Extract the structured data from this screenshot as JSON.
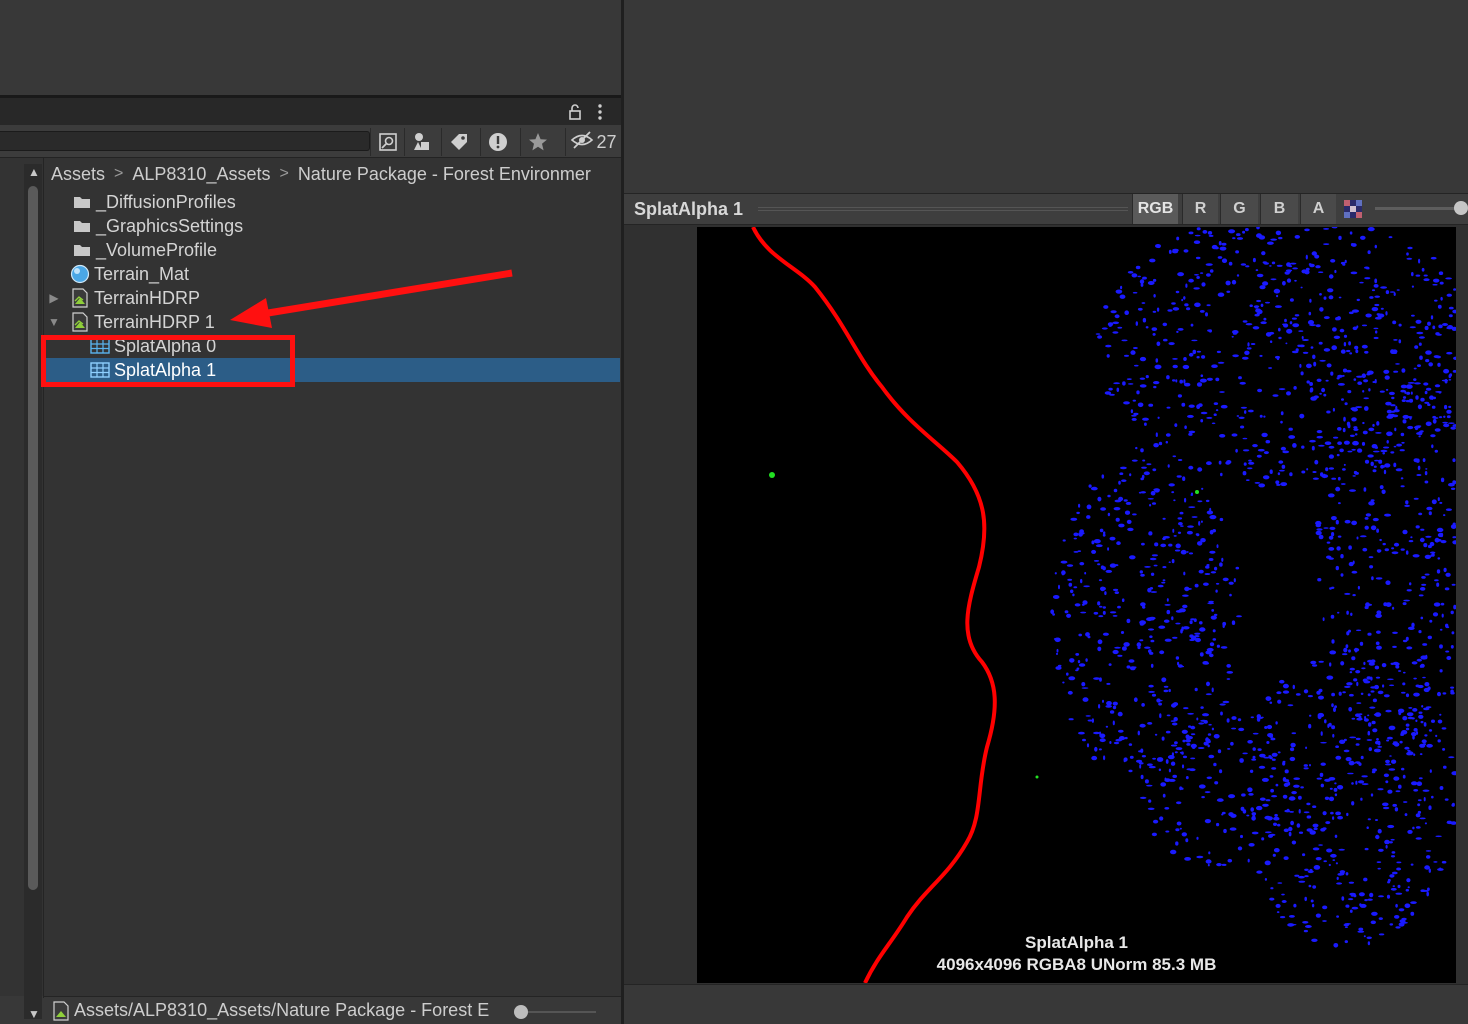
{
  "project": {
    "hidden_count": "27",
    "breadcrumb": [
      "Assets",
      "ALP8310_Assets",
      "Nature Package - Forest Environmer"
    ],
    "tree": [
      {
        "label": "_DiffusionProfiles",
        "icon": "folder-icon"
      },
      {
        "label": "_GraphicsSettings",
        "icon": "folder-icon"
      },
      {
        "label": "_VolumeProfile",
        "icon": "folder-icon"
      },
      {
        "label": "Terrain_Mat",
        "icon": "material-icon"
      },
      {
        "label": "TerrainHDRP",
        "icon": "terrain-data-icon",
        "foldout": "collapsed"
      },
      {
        "label": "TerrainHDRP 1",
        "icon": "terrain-data-icon",
        "foldout": "expanded"
      },
      {
        "label": "SplatAlpha 0",
        "icon": "texture-icon"
      },
      {
        "label": "SplatAlpha 1",
        "icon": "texture-icon",
        "selected": true
      }
    ],
    "status_path": "Assets/ALP8310_Assets/Nature Package - Forest E"
  },
  "preview": {
    "title": "SplatAlpha 1",
    "channels": [
      "RGB",
      "R",
      "G",
      "B",
      "A"
    ],
    "active_channel": "RGB",
    "info_name": "SplatAlpha 1",
    "info_details": "4096x4096  RGBA8 UNorm   85.3 MB"
  },
  "colors": {
    "selection": "#2c5d87",
    "annotation": "#ff1010",
    "splat_red": "#ff0000",
    "splat_blue": "#1a1aff"
  }
}
